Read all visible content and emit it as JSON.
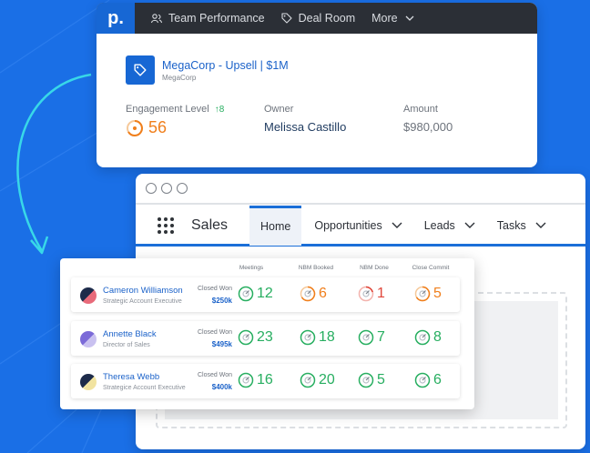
{
  "nav": {
    "logo": "p.",
    "items": [
      {
        "label": "Team Performance",
        "icon": "team-icon"
      },
      {
        "label": "Deal Room",
        "icon": "tag-icon"
      },
      {
        "label": "More",
        "icon": "chevron-down-icon"
      }
    ]
  },
  "deal": {
    "title": "MegaCorp - Upsell | $1M",
    "company": "MegaCorp",
    "engagement_label": "Engagement Level",
    "engagement_delta": "8",
    "engagement_value": "56",
    "owner_label": "Owner",
    "owner_value": "Melissa Castillo",
    "amount_label": "Amount",
    "amount_value": "$980,000"
  },
  "crm": {
    "app_name": "Sales",
    "tabs": [
      {
        "label": "Home",
        "active": true
      },
      {
        "label": "Opportunities"
      },
      {
        "label": "Leads"
      },
      {
        "label": "Tasks"
      }
    ]
  },
  "board": {
    "columns": [
      "Meetings",
      "NBM Booked",
      "NBM Done",
      "Close Commit"
    ],
    "closed_won_label": "Closed Won",
    "rows": [
      {
        "name": "Cameron Williamson",
        "role": "Strategic Account Executive",
        "closed_won": "$250k",
        "metrics": [
          "12",
          "6",
          "1",
          "5"
        ],
        "colors": [
          "#27ae60",
          "#f07f1c",
          "#e0463a",
          "#f07f1c"
        ]
      },
      {
        "name": "Annette Black",
        "role": "Director of Sales",
        "closed_won": "$495k",
        "metrics": [
          "23",
          "18",
          "7",
          "8"
        ],
        "colors": [
          "#27ae60",
          "#27ae60",
          "#27ae60",
          "#27ae60"
        ]
      },
      {
        "name": "Theresa Webb",
        "role": "Strategice Account Executive",
        "closed_won": "$400k",
        "metrics": [
          "16",
          "20",
          "5",
          "6"
        ],
        "colors": [
          "#27ae60",
          "#27ae60",
          "#27ae60",
          "#27ae60"
        ]
      }
    ]
  },
  "colors": {
    "background": "#1a6fe6",
    "accent": "#1767d4",
    "good": "#27ae60",
    "warn": "#f07f1c",
    "bad": "#e0463a"
  }
}
